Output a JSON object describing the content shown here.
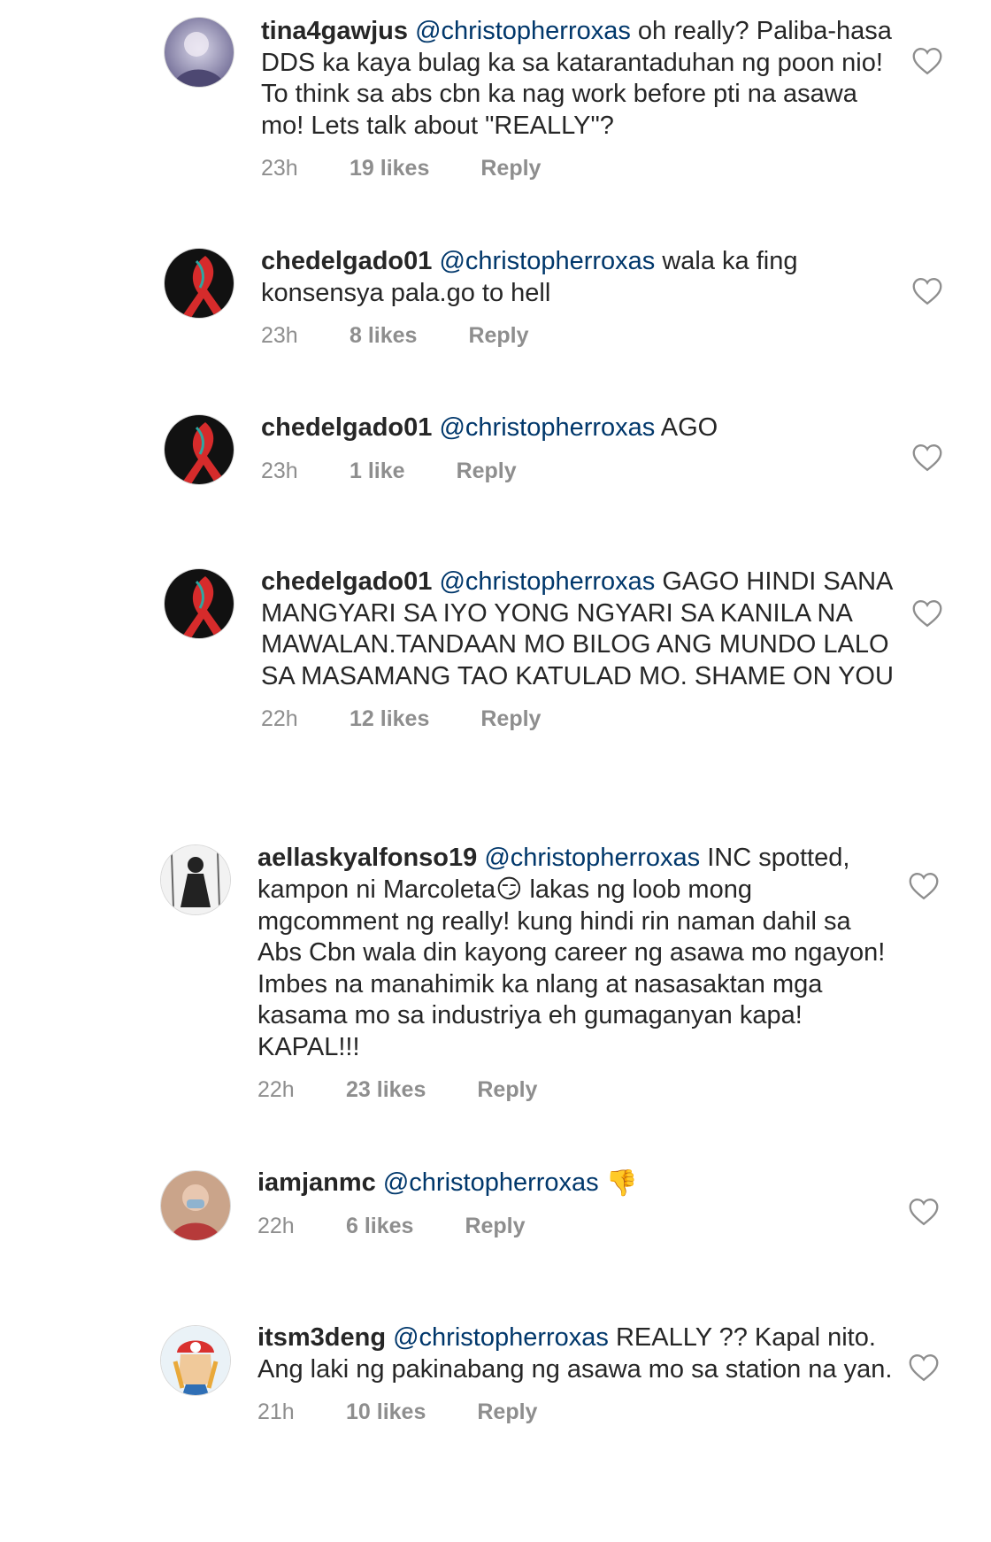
{
  "comments": [
    {
      "username": "tina4gawjus",
      "mention": "@christopherroxas",
      "text": " oh really? Paliba-hasa DDS ka kaya bulag ka sa katarantaduhan ng poon nio! To think sa abs cbn ka nag work before pti na asawa mo! Lets talk about \"REALLY\"?",
      "time": "23h",
      "likes": "19 likes",
      "reply": "Reply",
      "avatar": "avatar-blurry-photo"
    },
    {
      "username": "chedelgado01",
      "mention": "@christopherroxas",
      "text": " wala ka fing konsensya  pala.go to hell",
      "time": "23h",
      "likes": "8 likes",
      "reply": "Reply",
      "avatar": "black-ribbon"
    },
    {
      "username": "chedelgado01",
      "mention": "@christopherroxas",
      "text": " AGO",
      "time": "23h",
      "likes": "1 like",
      "reply": "Reply",
      "avatar": "black-ribbon"
    },
    {
      "username": "chedelgado01",
      "mention": "@christopherroxas",
      "text": " GAGO HINDI SANA MANGYARI SA IYO YONG NGYARI SA KANILA NA MAWALAN.TANDAAN MO BILOG ANG MUNDO LALO SA MASAMANG TAO KATULAD MO. SHAME ON YOU",
      "time": "22h",
      "likes": "12 likes",
      "reply": "Reply",
      "avatar": "black-ribbon"
    },
    {
      "username": "aellaskyalfonso19",
      "mention": "@christopherroxas",
      "text_a": " INC spotted, kampon ni Marcoleta",
      "emoji": "😏",
      "text_b": " lakas ng loob mong mgcomment ng really! kung hindi rin naman dahil sa Abs Cbn wala din kayong career ng asawa mo ngayon! Imbes na manahimik ka nlang at nasasaktan mga kasama mo sa industriya eh gumaganyan kapa! KAPAL!!!",
      "time": "22h",
      "likes": "23 likes",
      "reply": "Reply",
      "avatar": "sketch-figure"
    },
    {
      "username": "iamjanmc",
      "mention": "@christopherroxas",
      "emoji": "👎",
      "time": "22h",
      "likes": "6 likes",
      "reply": "Reply",
      "avatar": "masked-person-photo"
    },
    {
      "username": "itsm3deng",
      "mention": "@christopherroxas",
      "text": " REALLY ?? Kapal nito. Ang laki ng pakinabang ng asawa mo sa station na yan.",
      "time": "21h",
      "likes": "10 likes",
      "reply": "Reply",
      "avatar": "cartoon-character"
    }
  ],
  "colors": {
    "username": "#262626",
    "mention": "#00376b",
    "meta": "#8e8e8e",
    "ribbon": "#d62b2b"
  }
}
